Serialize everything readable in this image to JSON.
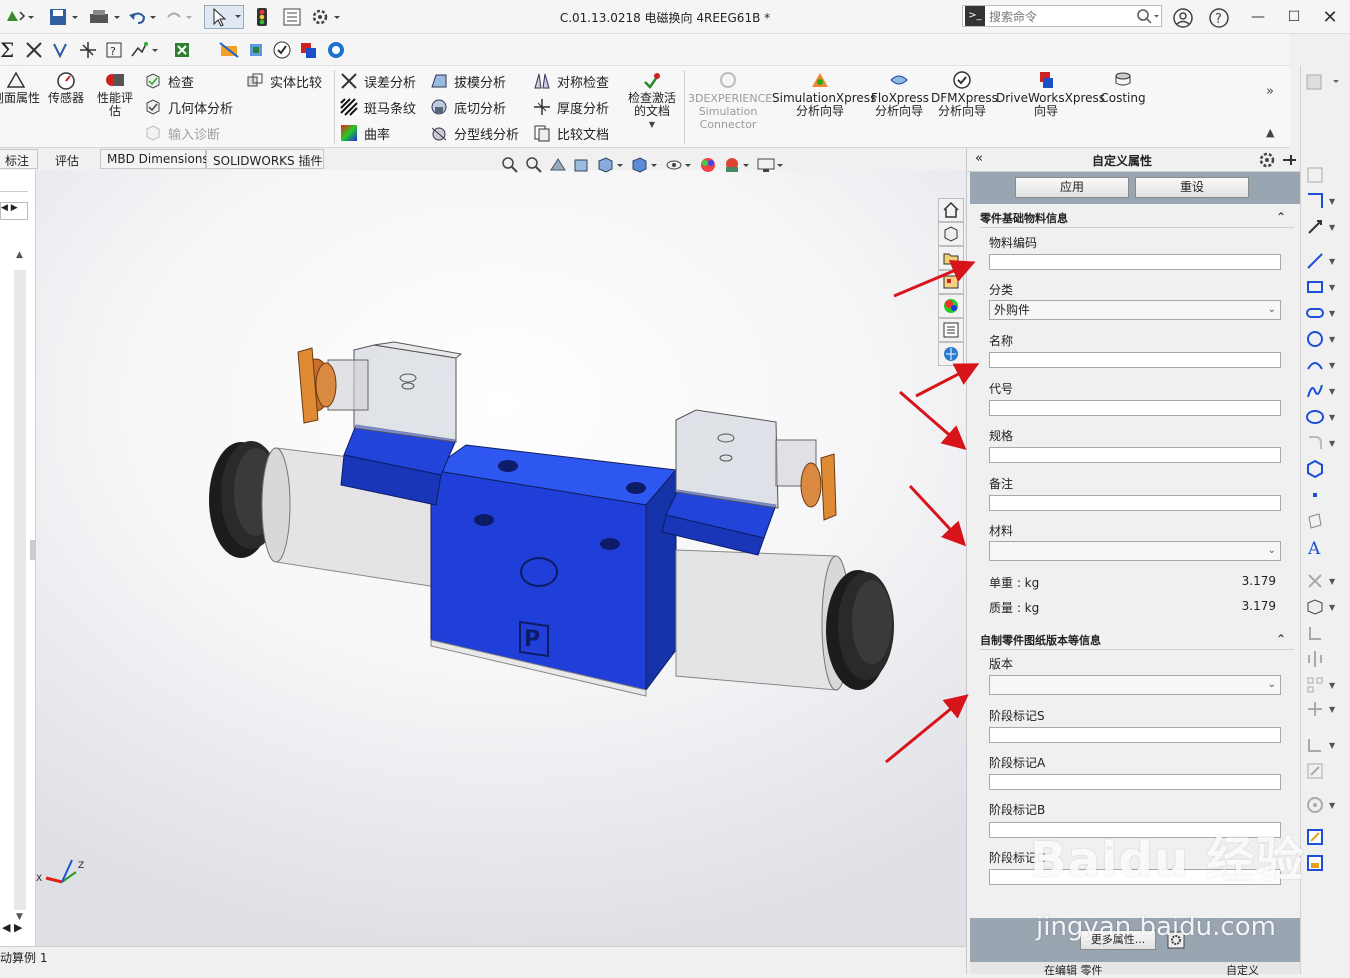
{
  "titlebar": {
    "document_title": "C.01.13.0218 电磁换向 4REEG61B *",
    "search_placeholder": "搜索命令"
  },
  "command_manager": {
    "big_buttons": [
      "剖面属性",
      "传感器",
      "性能评估"
    ],
    "check": "检查",
    "geometry_analysis": "几何体分析",
    "import_diagnostics": "输入诊断",
    "solid_compare": "实体比较",
    "deviation_analysis": "误差分析",
    "zebra_stripes": "斑马条纹",
    "curvature": "曲率",
    "draft_analysis": "拔模分析",
    "undercut_analysis": "底切分析",
    "parting_line_analysis": "分型线分析",
    "symmetry_check": "对称检查",
    "thickness_analysis": "厚度分析",
    "compare_documents": "比较文档",
    "check_active_document": "检查激活的文档",
    "experience_sim": "3DEXPERIENCE Simulation Connector",
    "simulationxpress": "SimulationXpress 分析向导",
    "floxpress": "FloXpress 分析向导",
    "dfmxpress": "DFMXpress 分析向导",
    "driveworksxpress": "DriveWorksXpress 向导",
    "costing": "Costing"
  },
  "tabs": [
    "标注",
    "评估",
    "MBD Dimensions",
    "SOLIDWORKS 插件"
  ],
  "status_bar": {
    "left": "动算例 1",
    "editing": "在编辑 零件",
    "custom": "自定义"
  },
  "model": {
    "port_label": "P",
    "triad_labels": [
      "Z",
      "X"
    ]
  },
  "custom_properties": {
    "title": "自定义属性",
    "apply": "应用",
    "reset": "重设",
    "section1": {
      "title": "零件基础物料信息",
      "material_code_label": "物料编码",
      "material_code_value": "",
      "category_label": "分类",
      "category_value": "外购件",
      "name_label": "名称",
      "name_value": "",
      "code_label": "代号",
      "code_value": "",
      "spec_label": "规格",
      "spec_value": "",
      "remark_label": "备注",
      "remark_value": "",
      "material_label": "材料",
      "material_value": "",
      "unit_weight_label": "单重 : kg",
      "unit_weight_value": "3.179",
      "mass_label": "质量 : kg",
      "mass_value": "3.179"
    },
    "section2": {
      "title": "自制零件图纸版本等信息",
      "version_label": "版本",
      "version_value": "",
      "stage_s_label": "阶段标记S",
      "stage_a_label": "阶段标记A",
      "stage_b_label": "阶段标记B",
      "stage_c_label": "阶段标记C"
    },
    "more_properties": "更多属性..."
  },
  "watermark": {
    "logo": "Baidu 经验",
    "url": "jingyan.baidu.com"
  },
  "colors": {
    "valve_blue": "#1f3fd8",
    "annotation_arrow": "#d8141b",
    "panel_bar": "#9aa5b2"
  }
}
